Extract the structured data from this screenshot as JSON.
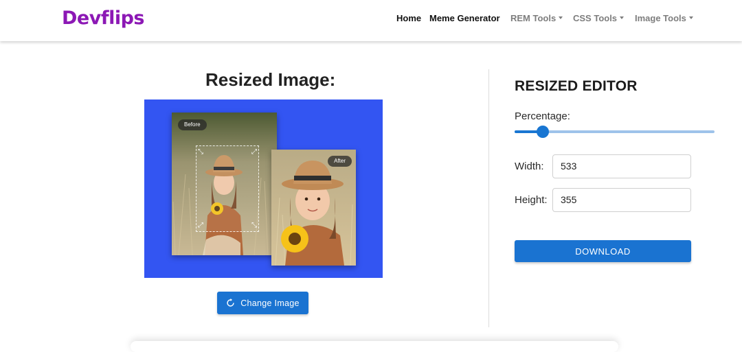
{
  "brand": {
    "name": "Devflips",
    "color": "#8c18b5"
  },
  "nav": {
    "home": "Home",
    "meme_generator": "Meme Generator",
    "rem_tools": "REM Tools",
    "css_tools": "CSS Tools",
    "image_tools": "Image Tools"
  },
  "left": {
    "title": "Resized Image:",
    "before_label": "Before",
    "after_label": "After",
    "change_button": "Change Image",
    "preview_bg": "#3355f2"
  },
  "editor": {
    "title": "RESIZED EDITOR",
    "percentage_label": "Percentage:",
    "percentage_value": 0.14,
    "width_label": "Width:",
    "width_value": "533",
    "height_label": "Height:",
    "height_value": "355",
    "download_button": "DOWNLOAD",
    "accent": "#1a73d1"
  },
  "icons": {
    "refresh": "refresh-icon",
    "resize": "resize-arrows-icon"
  }
}
